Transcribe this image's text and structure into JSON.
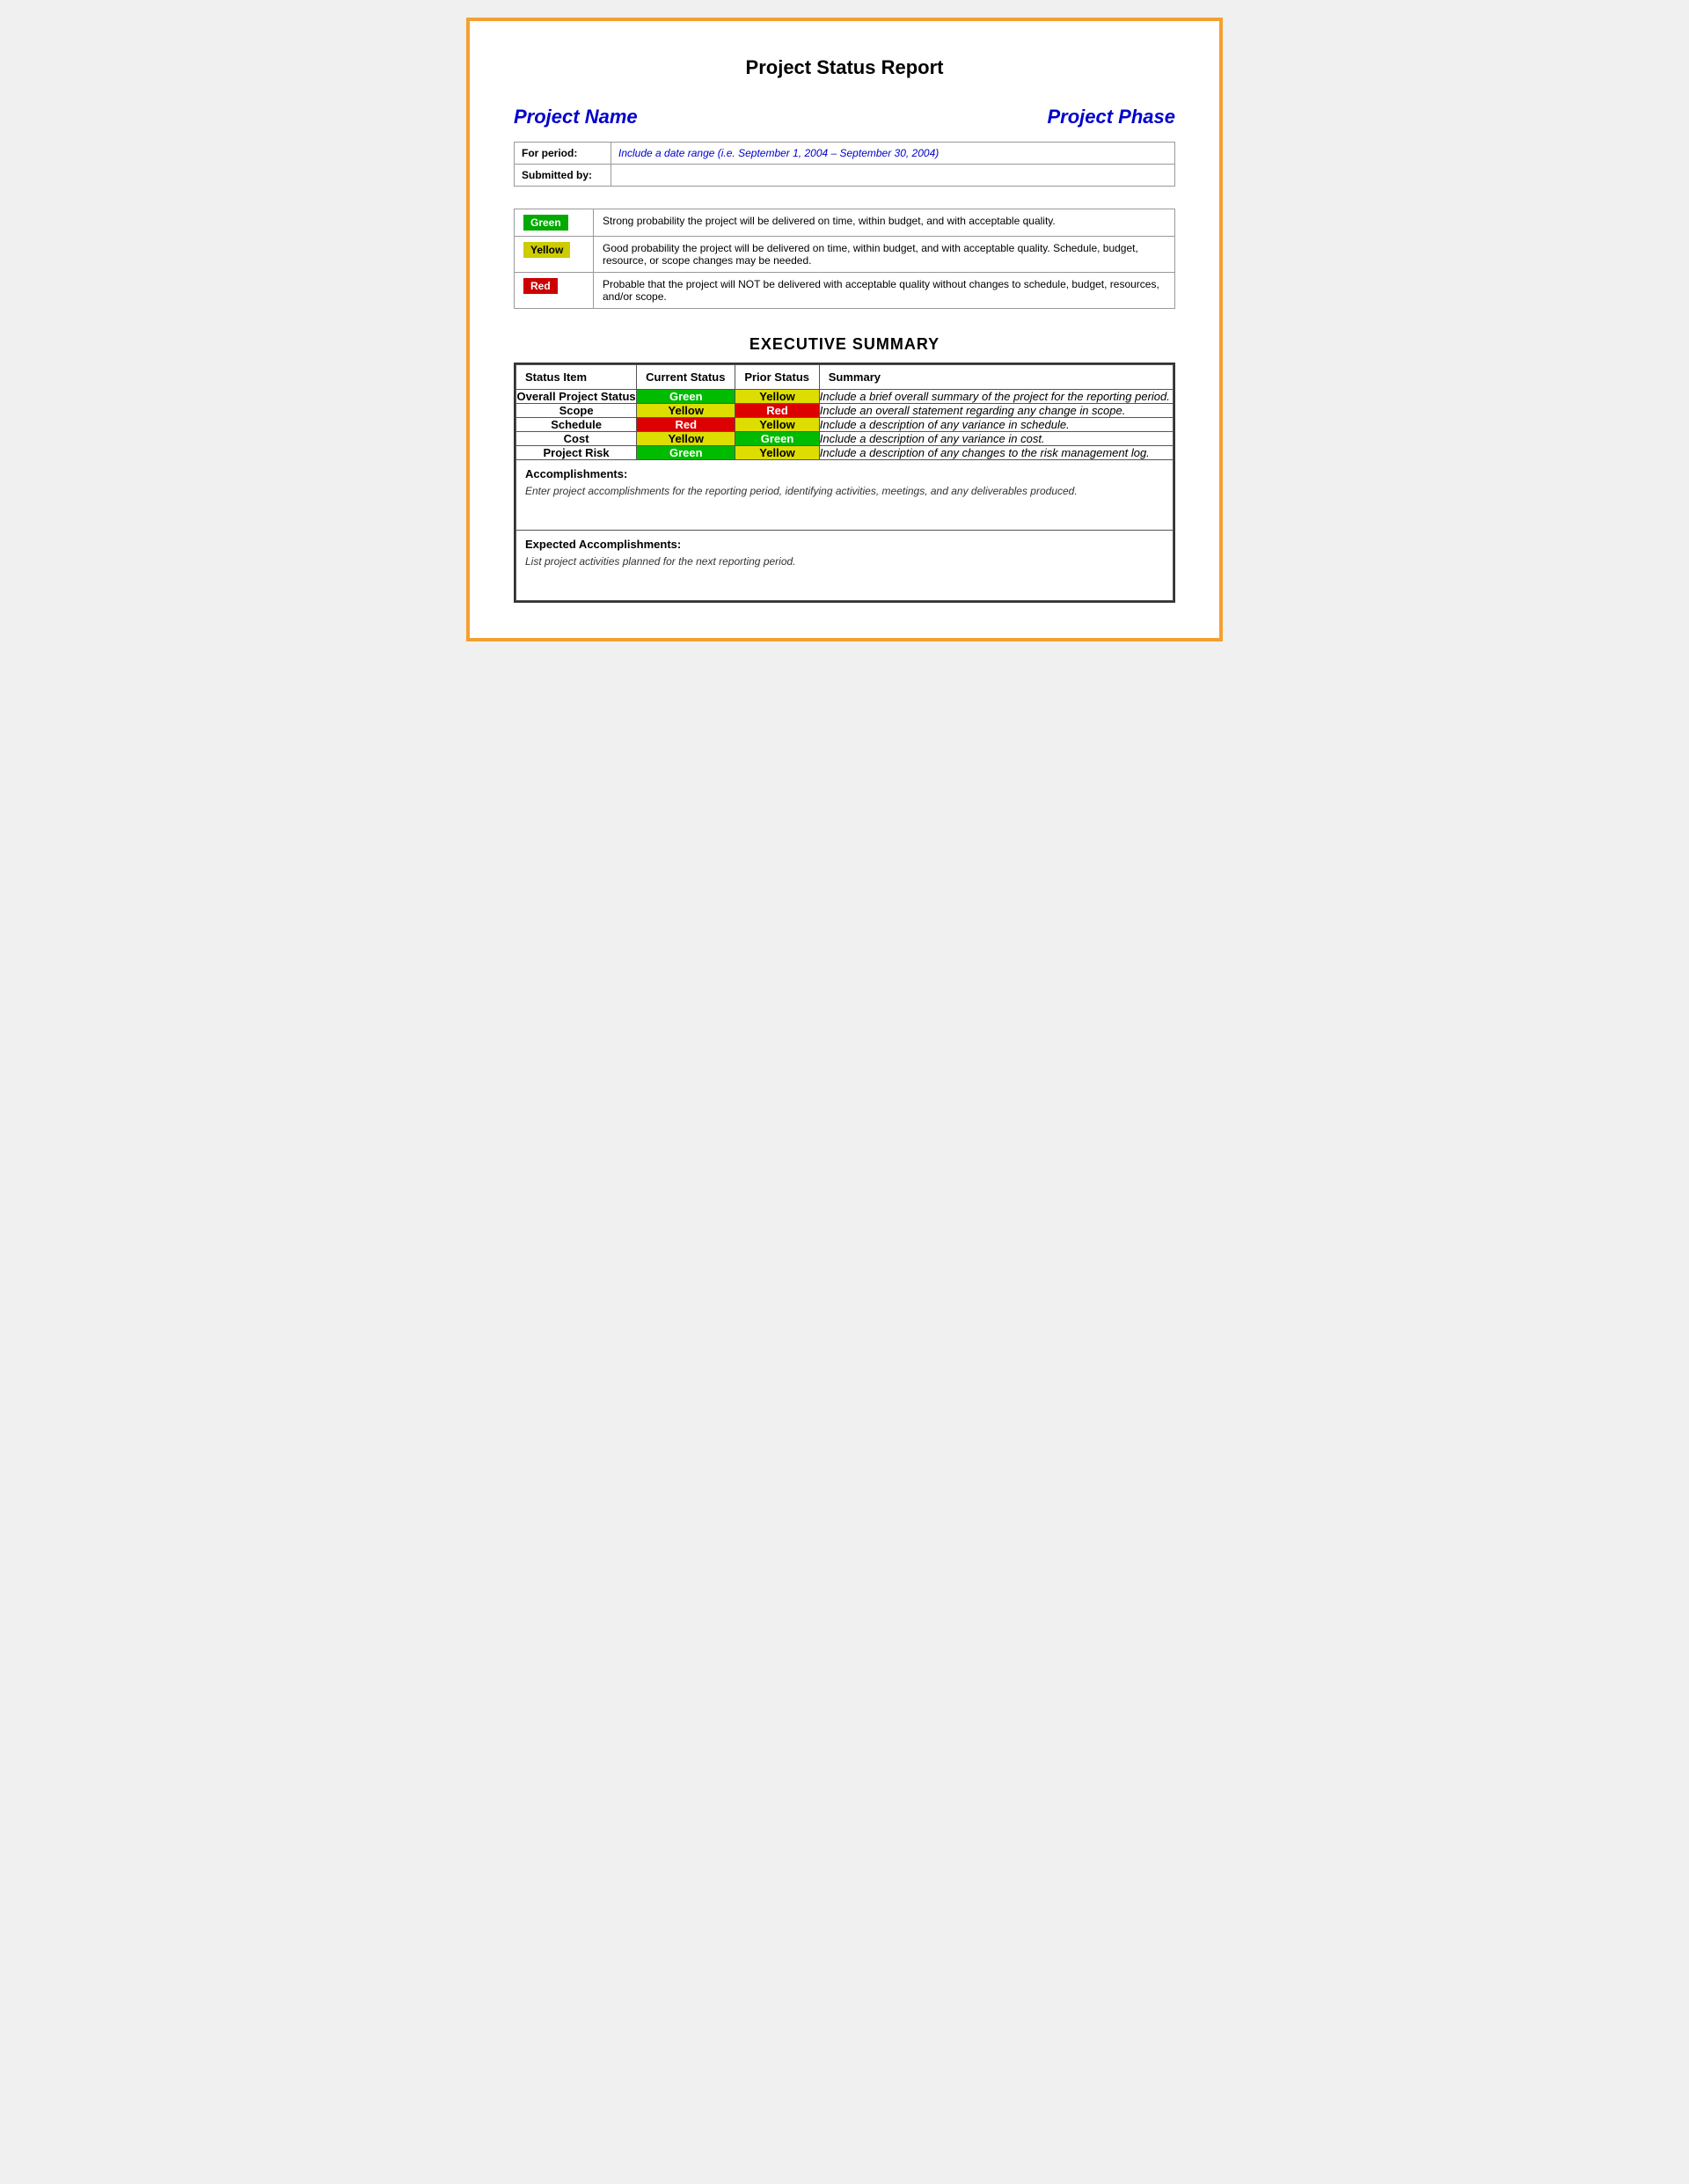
{
  "page": {
    "title": "Project Status Report",
    "border_color": "#F4A030"
  },
  "header": {
    "project_name_label": "Project Name",
    "project_phase_label": "Project Phase"
  },
  "info_rows": [
    {
      "label": "For period:",
      "value": "Include a date range (i.e. September 1, 2004 – September 30, 2004)"
    },
    {
      "label": "Submitted by:",
      "value": ""
    }
  ],
  "legend": [
    {
      "badge": "Green",
      "color": "green",
      "description": "Strong probability the project will be delivered on time, within budget, and with acceptable quality."
    },
    {
      "badge": "Yellow",
      "color": "yellow",
      "description": "Good probability the project will be delivered on time, within budget, and with acceptable quality. Schedule, budget, resource, or scope changes may be needed."
    },
    {
      "badge": "Red",
      "color": "red",
      "description": "Probable that the project will NOT be delivered with acceptable quality without changes to schedule, budget, resources, and/or scope."
    }
  ],
  "executive_summary": {
    "title": "EXECUTIVE SUMMARY",
    "headers": [
      "Status Item",
      "Current Status",
      "Prior Status",
      "Summary"
    ],
    "rows": [
      {
        "item": "Overall Project Status",
        "current_status": "Green",
        "current_color": "green",
        "prior_status": "Yellow",
        "prior_color": "yellow",
        "summary": "Include a brief overall summary of the project for the reporting period."
      },
      {
        "item": "Scope",
        "current_status": "Yellow",
        "current_color": "yellow",
        "prior_status": "Red",
        "prior_color": "red",
        "summary": "Include an overall statement regarding any change in scope."
      },
      {
        "item": "Schedule",
        "current_status": "Red",
        "current_color": "red",
        "prior_status": "Yellow",
        "prior_color": "yellow",
        "summary": "Include a description of any variance in schedule."
      },
      {
        "item": "Cost",
        "current_status": "Yellow",
        "current_color": "yellow",
        "prior_status": "Green",
        "prior_color": "green",
        "summary": "Include a description of any variance in cost."
      },
      {
        "item": "Project Risk",
        "current_status": "Green",
        "current_color": "green",
        "prior_status": "Yellow",
        "prior_color": "yellow",
        "summary": "Include a description of any changes to the risk management log."
      }
    ],
    "accomplishments": {
      "title": "Accomplishments:",
      "text": "Enter project accomplishments for the reporting period, identifying activities, meetings, and any deliverables produced."
    },
    "expected_accomplishments": {
      "title": "Expected Accomplishments:",
      "text": "List project activities planned for the next reporting period."
    }
  }
}
